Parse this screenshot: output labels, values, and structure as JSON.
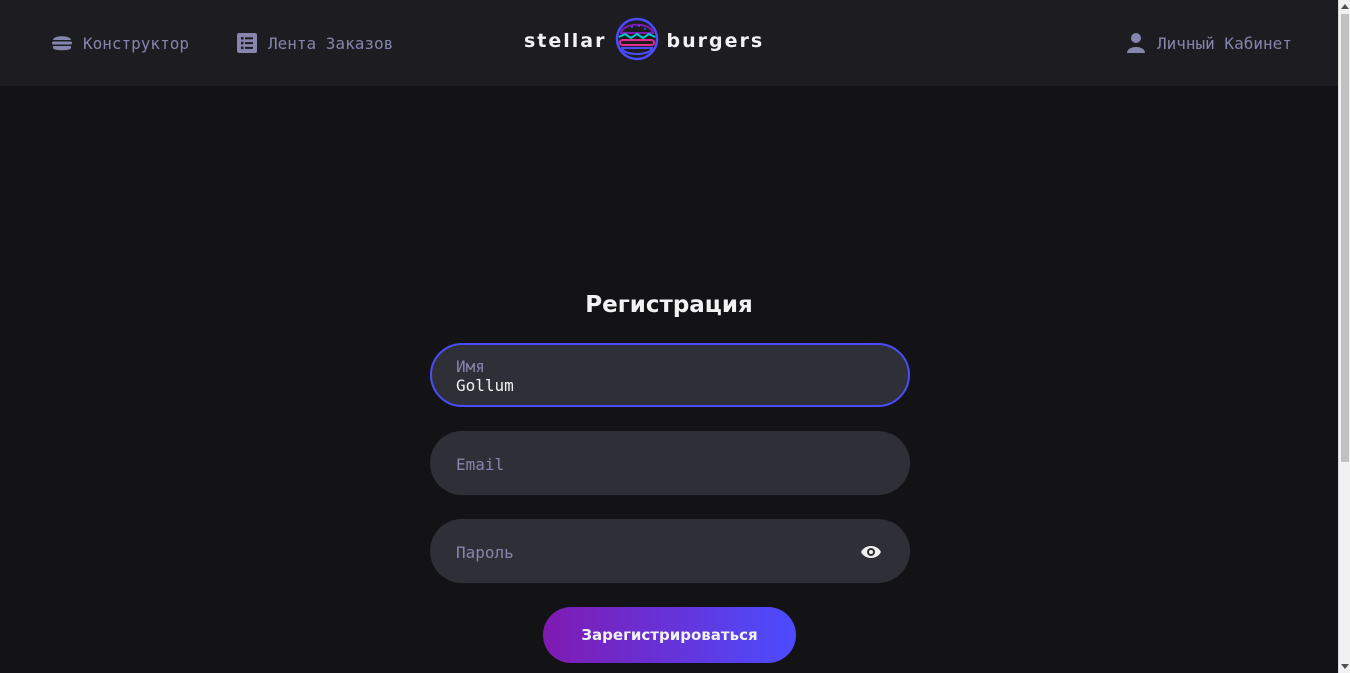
{
  "header": {
    "nav": {
      "constructor_label": "Конструктор",
      "feed_label": "Лента Заказов",
      "profile_label": "Личный Кабинет"
    },
    "logo": {
      "left_word": "stellar",
      "right_word": "burgers"
    }
  },
  "form": {
    "title": "Регистрация",
    "name_field": {
      "label": "Имя",
      "value": "Gollum"
    },
    "email_field": {
      "placeholder": "Email"
    },
    "password_field": {
      "placeholder": "Пароль"
    },
    "submit_label": "Зарегистрироваться"
  },
  "colors": {
    "background": "#131316",
    "header_bg": "#1c1c21",
    "input_bg": "#2f2f37",
    "accent": "#4c4cff",
    "button_gradient_start": "#801ab2",
    "muted_text": "#8585ad"
  },
  "icons": {
    "constructor": "burger-icon",
    "feed": "list-icon",
    "profile": "user-icon",
    "password_toggle": "eye-icon"
  }
}
